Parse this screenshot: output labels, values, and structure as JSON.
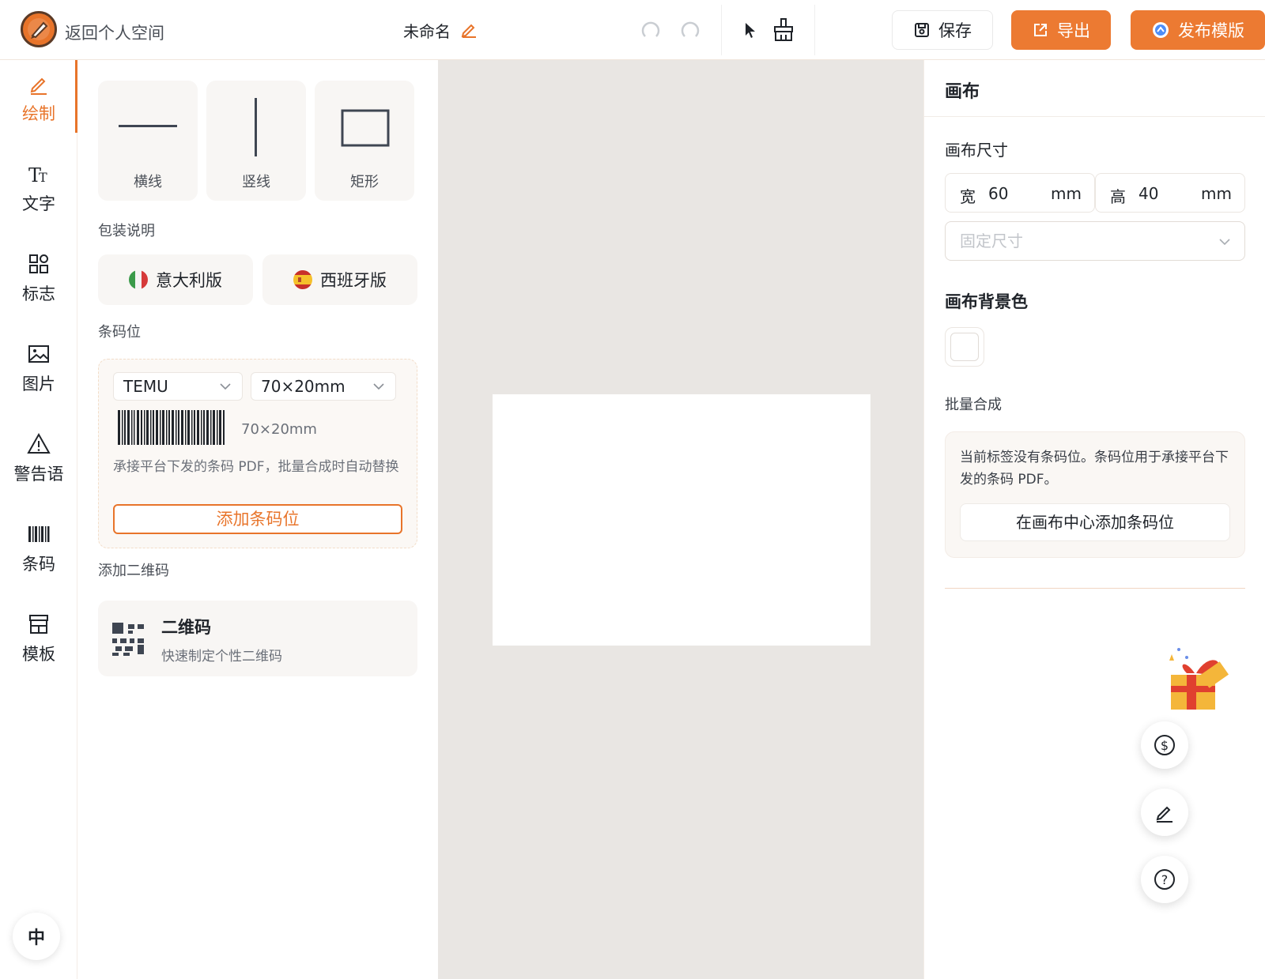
{
  "topbar": {
    "back_label": "返回个人空间",
    "doc_title": "未命名",
    "save_label": "保存",
    "export_label": "导出",
    "publish_label": "发布模版"
  },
  "rail": {
    "items": [
      {
        "label": "绘制",
        "icon": "pencil-icon"
      },
      {
        "label": "文字",
        "icon": "text-icon"
      },
      {
        "label": "标志",
        "icon": "grid-icon"
      },
      {
        "label": "图片",
        "icon": "image-icon"
      },
      {
        "label": "警告语",
        "icon": "warning-icon"
      },
      {
        "label": "条码",
        "icon": "barcode-icon"
      },
      {
        "label": "模板",
        "icon": "store-icon"
      }
    ],
    "lang": "中"
  },
  "panel": {
    "shapes": [
      {
        "label": "横线"
      },
      {
        "label": "竖线"
      },
      {
        "label": "矩形"
      }
    ],
    "packaging_title": "包装说明",
    "packaging": [
      {
        "label": "意大利版"
      },
      {
        "label": "西班牙版"
      }
    ],
    "barcode_title": "条码位",
    "barcode": {
      "platform": "TEMU",
      "size_select": "70×20mm",
      "size_text": "70×20mm",
      "desc": "承接平台下发的条码 PDF，批量合成时自动替换",
      "add_label": "添加条码位"
    },
    "qr_title": "添加二维码",
    "qr": {
      "title": "二维码",
      "subtitle": "快速制定个性二维码"
    }
  },
  "right": {
    "title": "画布",
    "size_label": "画布尺寸",
    "width_key": "宽",
    "width_value": "60",
    "height_key": "高",
    "height_value": "40",
    "unit": "mm",
    "size_mode_placeholder": "固定尺寸",
    "bg_label": "画布背景色",
    "bg_color": "#ffffff",
    "batch_label": "批量合成",
    "batch_desc": "当前标签没有条码位。条码位用于承接平台下发的条码 PDF。",
    "batch_button": "在画布中心添加条码位"
  },
  "colors": {
    "accent": "#ec7a32",
    "canvas_bg": "#e9e6e3"
  }
}
